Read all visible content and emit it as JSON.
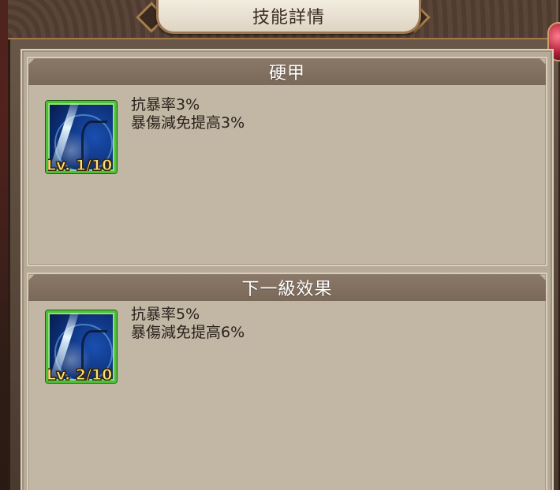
{
  "window": {
    "title": "技能詳情"
  },
  "current": {
    "header": "硬甲",
    "icon": "blue-slash-antler-icon",
    "level": "Lv. 1/10",
    "effects": [
      "抗暴率3%",
      "暴傷減免提高3%"
    ]
  },
  "next": {
    "header": "下一級效果",
    "icon": "blue-slash-antler-icon",
    "level": "Lv. 2/10",
    "effects": [
      "抗暴率5%",
      "暴傷減免提高6%"
    ]
  },
  "colors": {
    "panel": "#b7ab98",
    "header_bar": "#7a6858",
    "icon_border": "#4fbf3a",
    "level_text": "#f6e27a"
  }
}
